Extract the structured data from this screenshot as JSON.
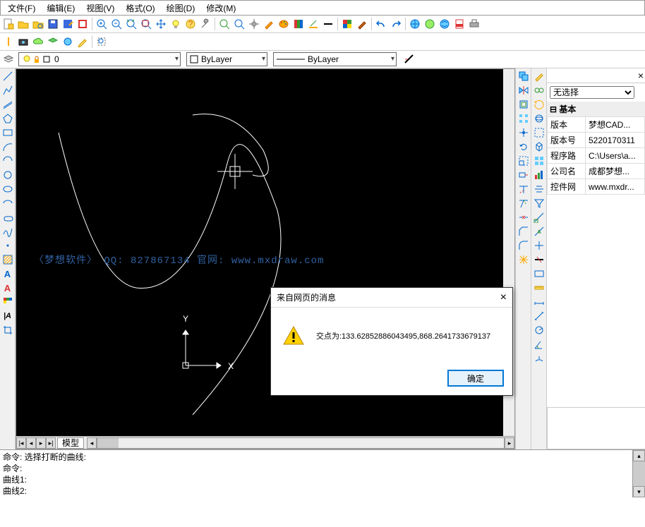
{
  "menu": {
    "items": [
      "文件(F)",
      "编辑(E)",
      "视图(V)",
      "格式(O)",
      "绘图(D)",
      "修改(M)"
    ]
  },
  "toolbar1_icons": [
    "new-doc",
    "open",
    "save",
    "save-as",
    "refresh",
    "import",
    "zoom-in",
    "zoom-out",
    "zoom-window",
    "zoom-extents",
    "pan",
    "crosshair",
    "bulb",
    "help",
    "wrench",
    "find",
    "zoom-realtime",
    "target",
    "brush",
    "palette",
    "layers-ico",
    "underline",
    "line-btn",
    "color-swatch",
    "brush2",
    "undo",
    "redo",
    "world",
    "globe-green",
    "globe-blue",
    "pdf",
    "printer"
  ],
  "toolbar2_icons": [
    "divider",
    "camera",
    "cloud",
    "layer-green",
    "circle-blue",
    "pencil",
    "pipe",
    "rect-select"
  ],
  "layer_row": {
    "layer_value": "0",
    "color_combo": "ByLayer",
    "linetype_combo": "ByLayer"
  },
  "left_tool_icons": [
    "line",
    "pline",
    "mline",
    "polygon",
    "rect",
    "arc",
    "arc2",
    "circle",
    "ellipse",
    "ell-arc",
    "rev-cloud",
    "spline",
    "point",
    "hatch",
    "text-mt",
    "text-a",
    "pattern",
    "text-ia",
    "crop"
  ],
  "right_col1_icons": [
    "copy-ent",
    "mirror",
    "offset",
    "array",
    "move",
    "rotate",
    "scale",
    "stretch",
    "trim",
    "extend",
    "break",
    "chamfer",
    "fillet",
    "explode"
  ],
  "right_col2_icons": [
    "brush-tool",
    "group",
    "cycle",
    "3dorbit",
    "box-sel",
    "cube",
    "grid-view",
    "bar-chart",
    "align-h",
    "filter",
    "snap-end",
    "snap-mid",
    "snap-perp",
    "strike",
    "rect2",
    "ruler",
    "dim1",
    "dim2",
    "cross-circ",
    "angle-dim",
    "arc-m"
  ],
  "props": {
    "close_label": "×",
    "selector": "无选择",
    "category": "基本",
    "rows": [
      {
        "k": "版本",
        "v": "梦想CAD..."
      },
      {
        "k": "版本号",
        "v": "5220170311"
      },
      {
        "k": "程序路",
        "v": "C:\\Users\\a..."
      },
      {
        "k": "公司名",
        "v": "成都梦想..."
      },
      {
        "k": "控件网",
        "v": "www.mxdr..."
      }
    ]
  },
  "tabs": {
    "model": "模型"
  },
  "cmd": {
    "lines": [
      "命令:  选择打断的曲线:",
      "命令:",
      "曲线1:",
      "曲线2:"
    ]
  },
  "canvas": {
    "watermark": "〈梦想软件〉 QQ: 827867134  官网: www.mxdraw.com",
    "axis": {
      "x_label": "X",
      "y_label": "Y"
    }
  },
  "dialog": {
    "title": "来自网页的消息",
    "message": "交点为:133.62852886043495,868.2641733679137",
    "ok": "确定"
  }
}
